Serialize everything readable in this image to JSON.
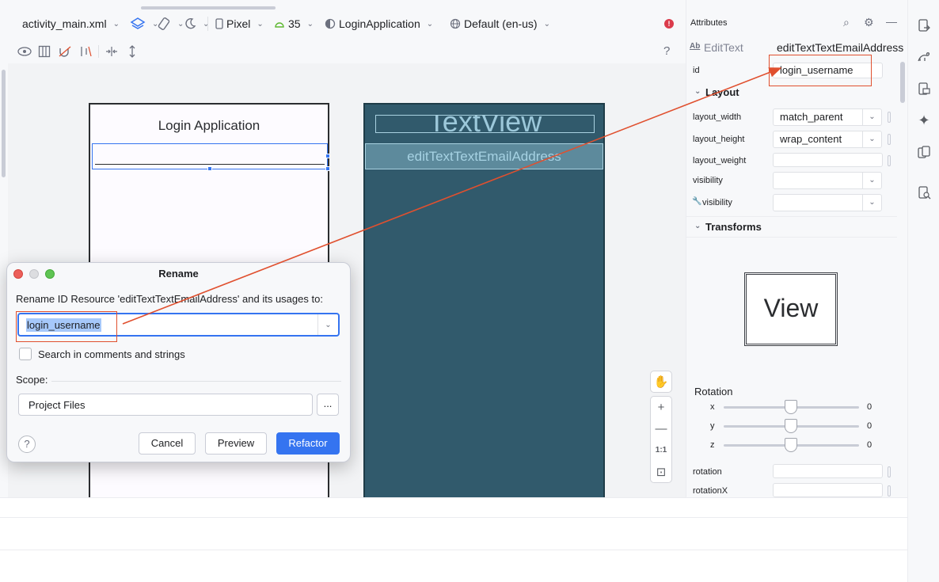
{
  "toolbar": {
    "file": "activity_main.xml",
    "device": "Pixel",
    "api_level": "35",
    "theme": "LoginApplication",
    "locale": "Default (en-us)"
  },
  "design_preview": {
    "title": "Login Application"
  },
  "blueprint_preview": {
    "textview_label": "TextView",
    "edittext_label": "editTextTextEmailAddress"
  },
  "zoom": {
    "fit_label": "1:1"
  },
  "attributes": {
    "panel_title": "Attributes",
    "widget_type_badge": "Ab",
    "widget_type": "EditText",
    "widget_id_header": "editTextTextEmailAddress",
    "id_label": "id",
    "id_value": "login_username",
    "layout_section": "Layout",
    "rows": [
      {
        "label": "layout_width",
        "value": "match_parent"
      },
      {
        "label": "layout_height",
        "value": "wrap_content"
      },
      {
        "label": "layout_weight",
        "value": ""
      },
      {
        "label": "visibility",
        "value": ""
      },
      {
        "label": "visibility",
        "value": ""
      }
    ],
    "transforms_section": "Transforms",
    "view_preview": "View",
    "rotation_title": "Rotation",
    "rotation": [
      {
        "axis": "x",
        "value": "0"
      },
      {
        "axis": "y",
        "value": "0"
      },
      {
        "axis": "z",
        "value": "0"
      }
    ],
    "extra_rows": [
      {
        "label": "rotation"
      },
      {
        "label": "rotationX"
      }
    ]
  },
  "dialog": {
    "title": "Rename",
    "prompt": "Rename ID Resource 'editTextTextEmailAddress' and its usages to:",
    "new_name": "login_username",
    "checkbox_label": "Search in comments and strings",
    "checkbox_checked": false,
    "scope_label": "Scope:",
    "scope_value": "Project Files",
    "more_button": "...",
    "help": "?",
    "cancel": "Cancel",
    "preview": "Preview",
    "refactor": "Refactor"
  },
  "colors": {
    "accent": "#3574f0",
    "annotation": "#e0502f",
    "blueprint": "#315a6c",
    "error": "#db3b4b"
  }
}
